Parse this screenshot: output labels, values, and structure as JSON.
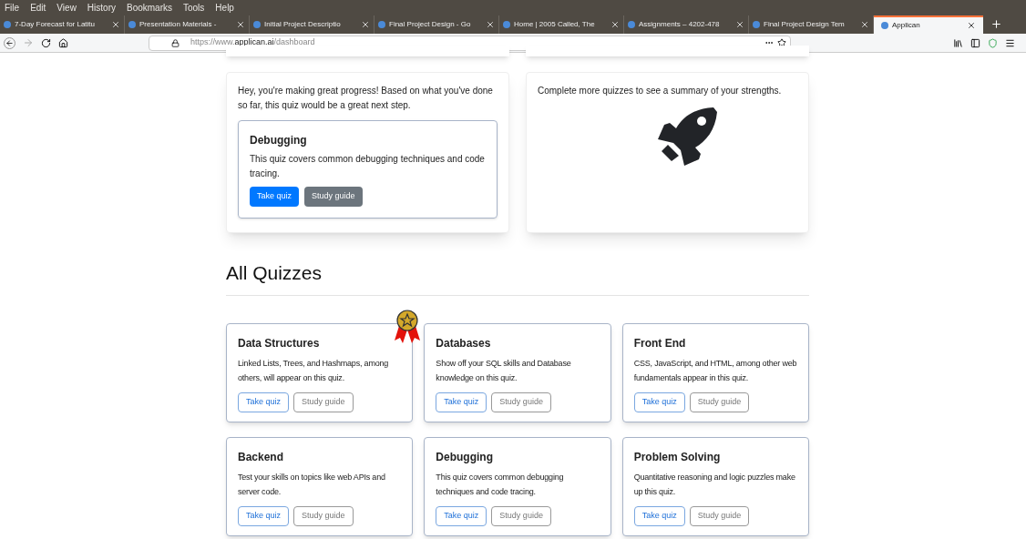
{
  "menu": [
    "File",
    "Edit",
    "View",
    "History",
    "Bookmarks",
    "Tools",
    "Help"
  ],
  "tabs": [
    {
      "title": "7-Day Forecast for Latitu",
      "selected": false
    },
    {
      "title": "Presentation Materials -",
      "selected": false
    },
    {
      "title": "Initial Project Descriptio",
      "selected": false
    },
    {
      "title": "Final Project Design - Go",
      "selected": false
    },
    {
      "title": "Home | 2005 Called, The",
      "selected": false
    },
    {
      "title": "Assignments – 4202-478",
      "selected": false
    },
    {
      "title": "Final Project Design Tem",
      "selected": false
    },
    {
      "title": "Applican",
      "selected": true
    }
  ],
  "address": {
    "prefix": "https://www.",
    "domain": "applican.ai",
    "path": "/dashboard"
  },
  "recommendation": {
    "intro": "Hey, you're making great progress! Based on what you've done so far, this quiz would be a great next step.",
    "quiz": {
      "title": "Debugging",
      "description": "This quiz covers common debugging techniques and code tracing.",
      "take": "Take quiz",
      "guide": "Study guide"
    }
  },
  "strengths": {
    "message": "Complete more quizzes to see a summary of your strengths."
  },
  "all_quizzes": {
    "heading": "All Quizzes",
    "quizzes": [
      {
        "title": "Data Structures",
        "description": "Linked Lists, Trees, and Hashmaps, among others, will appear on this quiz.",
        "take": "Take quiz",
        "guide": "Study guide",
        "badge": true
      },
      {
        "title": "Databases",
        "description": "Show off your SQL skills and Database knowledge on this quiz.",
        "take": "Take quiz",
        "guide": "Study guide",
        "badge": false
      },
      {
        "title": "Front End",
        "description": "CSS, JavaScript, and HTML, among other web fundamentals appear in this quiz.",
        "take": "Take quiz",
        "guide": "Study guide",
        "badge": false
      },
      {
        "title": "Backend",
        "description": "Test your skills on topics like web APIs and server code.",
        "take": "Take quiz",
        "guide": "Study guide",
        "badge": false
      },
      {
        "title": "Debugging",
        "description": "This quiz covers common debugging techniques and code tracing.",
        "take": "Take quiz",
        "guide": "Study guide",
        "badge": false
      },
      {
        "title": "Problem Solving",
        "description": "Quantitative reasoning and logic puzzles make up this quiz.",
        "take": "Take quiz",
        "guide": "Study guide",
        "badge": false
      }
    ]
  }
}
